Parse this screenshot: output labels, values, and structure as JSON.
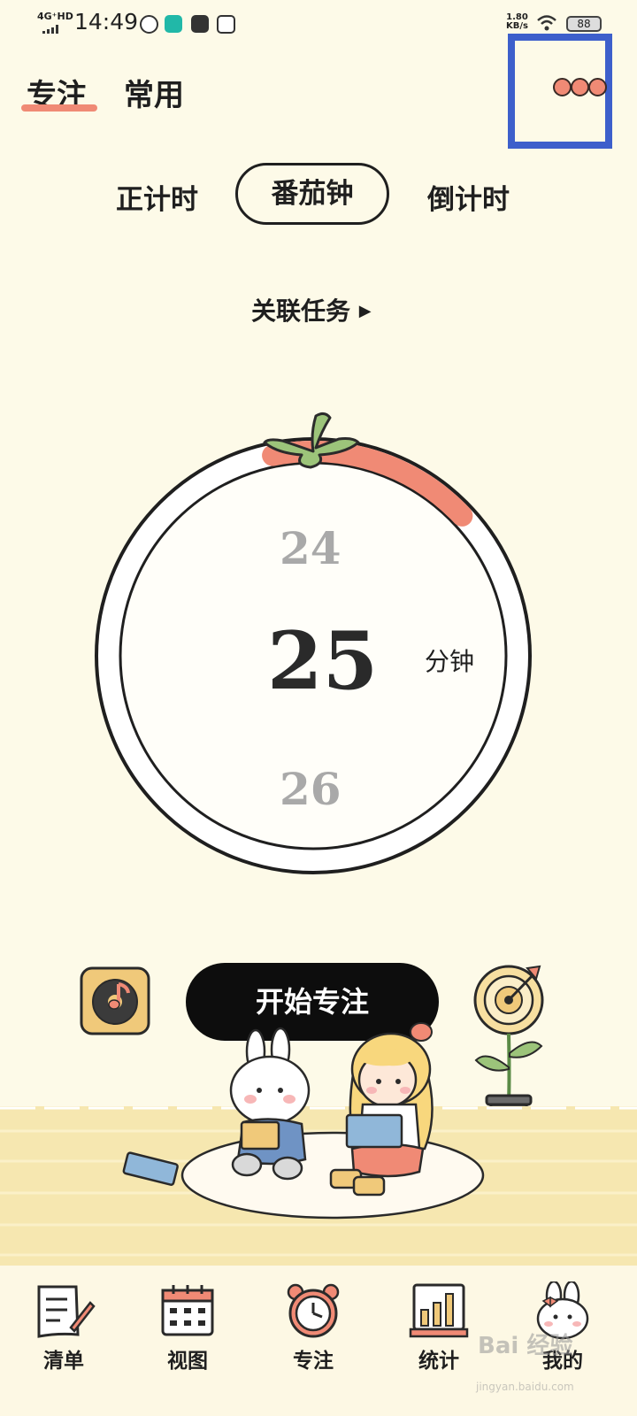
{
  "status_bar": {
    "network": "4G⁺HD",
    "time": "14:49",
    "speed": "1.80",
    "speed_unit": "KB/s",
    "battery": "88"
  },
  "top_tabs": [
    {
      "label": "专注",
      "active": true
    },
    {
      "label": "常用",
      "active": false
    }
  ],
  "more_button": {
    "icon": "more-dots-icon"
  },
  "timer_modes": [
    {
      "label": "正计时",
      "active": false
    },
    {
      "label": "番茄钟",
      "active": true
    },
    {
      "label": "倒计时",
      "active": false
    }
  ],
  "link_task": {
    "label": "关联任务",
    "icon": "triangle-right-icon"
  },
  "dial": {
    "previous": "24",
    "current": "25",
    "next": "26",
    "unit": "分钟",
    "progress_fraction": 0.13
  },
  "actions": {
    "music_icon": "music-record-icon",
    "start_label": "开始专注",
    "target_icon": "target-icon"
  },
  "bottom_nav": [
    {
      "label": "清单",
      "icon": "list-icon"
    },
    {
      "label": "视图",
      "icon": "calendar-icon"
    },
    {
      "label": "专注",
      "icon": "alarm-clock-icon"
    },
    {
      "label": "统计",
      "icon": "bar-chart-icon"
    },
    {
      "label": "我的",
      "icon": "bunny-avatar-icon"
    }
  ],
  "watermark": {
    "text": "Bai 经验",
    "sub": "jingyan.baidu.com"
  },
  "colors": {
    "background": "#fdfae8",
    "accent": "#f08a75",
    "highlight_box": "#3d5fcb",
    "leaf": "#9cc47a"
  }
}
